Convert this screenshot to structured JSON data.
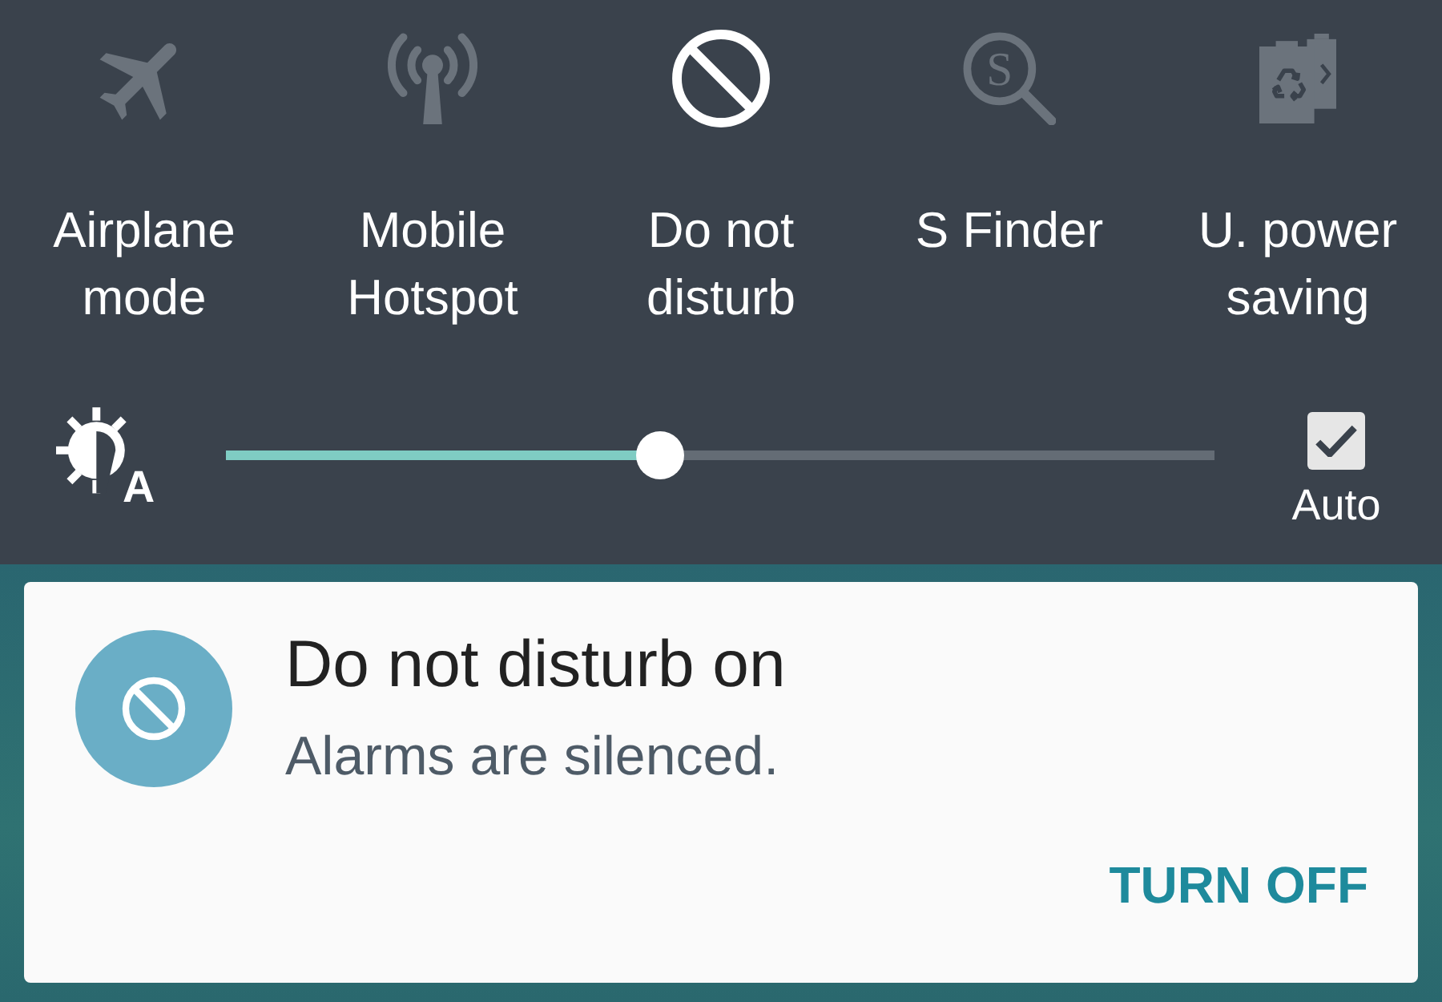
{
  "quick_settings": [
    {
      "kind": "airplane",
      "label": "Airplane mode",
      "on": false
    },
    {
      "kind": "hotspot",
      "label": "Mobile Hotspot",
      "on": false
    },
    {
      "kind": "do_not_disturb",
      "label": "Do not disturb",
      "on": true
    },
    {
      "kind": "finder",
      "label": "S Finder",
      "on": false,
      "icon_letter": "S"
    },
    {
      "kind": "power_saving",
      "label": "U. power saving",
      "on": false
    }
  ],
  "brightness": {
    "icon_letter": "A",
    "level": 0.44,
    "auto": {
      "label": "Auto",
      "checked": true
    }
  },
  "notification": {
    "title": "Do not disturb on",
    "text": "Alarms are silenced.",
    "action": "TURN OFF"
  }
}
